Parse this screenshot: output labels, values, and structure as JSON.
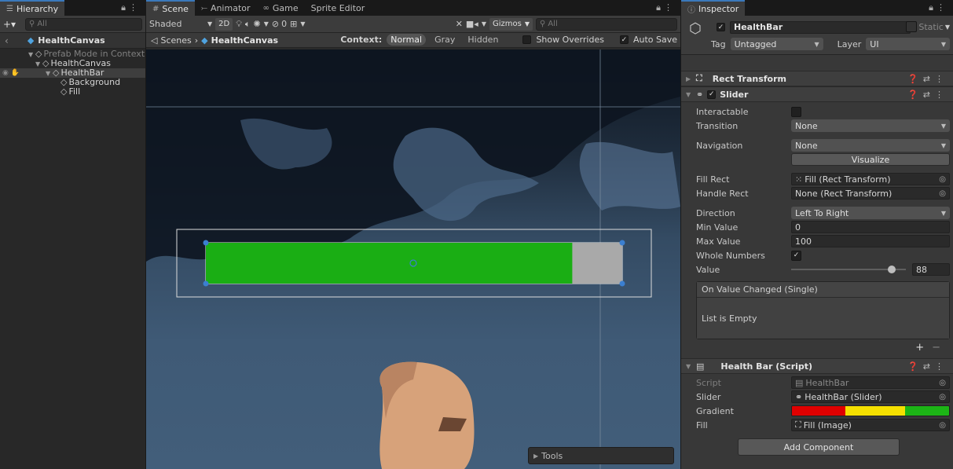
{
  "hierarchy": {
    "tab_label": "Hierarchy",
    "search_placeholder": "All",
    "add_label": "+▾",
    "header_title": "HealthCanvas",
    "items": [
      {
        "label": "Prefab Mode in Context"
      },
      {
        "label": "HealthCanvas"
      },
      {
        "label": "HealthBar"
      },
      {
        "label": "Background"
      },
      {
        "label": "Fill"
      }
    ]
  },
  "scene": {
    "tabs": [
      {
        "label": "Scene"
      },
      {
        "label": "Animator"
      },
      {
        "label": "Game"
      },
      {
        "label": "Sprite Editor"
      }
    ],
    "shading_mode": "Shaded",
    "btn_2d": "2D",
    "hidden_count": "0",
    "gizmos_label": "Gizmos",
    "search_placeholder": "All",
    "breadcrumb_root": "Scenes",
    "breadcrumb_current": "HealthCanvas",
    "context_label": "Context:",
    "context_modes": [
      "Normal",
      "Gray",
      "Hidden"
    ],
    "show_overrides": "Show Overrides",
    "auto_save": "Auto Save",
    "tools_label": "Tools",
    "healthbar_value": 88,
    "healthbar_max": 100,
    "fill_color": "#1aae14",
    "background_color": "#a9a9a9"
  },
  "inspector": {
    "tab_label": "Inspector",
    "object_name": "HealthBar",
    "static_label": "Static",
    "tag_label": "Tag",
    "tag_value": "Untagged",
    "layer_label": "Layer",
    "layer_value": "UI",
    "rect_transform_title": "Rect Transform",
    "slider": {
      "title": "Slider",
      "interactable_label": "Interactable",
      "transition_label": "Transition",
      "transition_value": "None",
      "navigation_label": "Navigation",
      "navigation_value": "None",
      "visualize_label": "Visualize",
      "fill_rect_label": "Fill Rect",
      "fill_rect_value": "Fill (Rect Transform)",
      "handle_rect_label": "Handle Rect",
      "handle_rect_value": "None (Rect Transform)",
      "direction_label": "Direction",
      "direction_value": "Left To Right",
      "min_value_label": "Min Value",
      "min_value": "0",
      "max_value_label": "Max Value",
      "max_value": "100",
      "whole_numbers_label": "Whole Numbers",
      "value_label": "Value",
      "value": "88",
      "event_title": "On Value Changed (Single)",
      "event_empty": "List is Empty"
    },
    "script_component": {
      "title": "Health Bar (Script)",
      "script_label": "Script",
      "script_value": "HealthBar",
      "slider_label": "Slider",
      "slider_value": "HealthBar (Slider)",
      "gradient_label": "Gradient",
      "fill_label": "Fill",
      "fill_value": "Fill (Image)"
    },
    "add_component_label": "Add Component"
  }
}
